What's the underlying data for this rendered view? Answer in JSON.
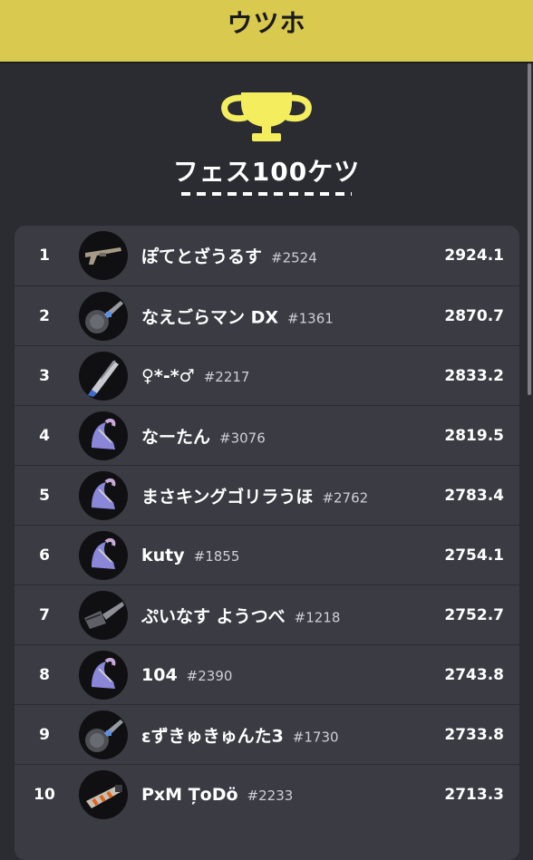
{
  "header": {
    "title": "ウツホ"
  },
  "section": {
    "title": "フェス100ケツ"
  },
  "colors": {
    "header_bg": "#d9c94f",
    "trophy": "#f4ee5e",
    "page_bg": "#2b2c32",
    "row_bg": "#3a3b43"
  },
  "rows": [
    {
      "rank": "1",
      "name": "ぽてとざうるす",
      "tag": "#2524",
      "score": "2924.1",
      "icon": "rifle-weapon-icon"
    },
    {
      "rank": "2",
      "name": "なえごらマン DX",
      "tag": "#1361",
      "score": "2870.7",
      "icon": "roller-weapon-icon"
    },
    {
      "rank": "3",
      "name": "♀*-*♂",
      "tag": "#2217",
      "score": "2833.2",
      "icon": "splatana-weapon-icon"
    },
    {
      "rank": "4",
      "name": "なーたん",
      "tag": "#3076",
      "score": "2819.5",
      "icon": "stringer-weapon-icon"
    },
    {
      "rank": "5",
      "name": "まさキングゴリラうほ",
      "tag": "#2762",
      "score": "2783.4",
      "icon": "stringer-weapon-icon"
    },
    {
      "rank": "6",
      "name": "kuty",
      "tag": "#1855",
      "score": "2754.1",
      "icon": "stringer-weapon-icon"
    },
    {
      "rank": "7",
      "name": "ぷいなす ようつべ",
      "tag": "#1218",
      "score": "2752.7",
      "icon": "brush-weapon-icon"
    },
    {
      "rank": "8",
      "name": "104",
      "tag": "#2390",
      "score": "2743.8",
      "icon": "stringer-weapon-icon"
    },
    {
      "rank": "9",
      "name": "εずきゅきゅんた3",
      "tag": "#1730",
      "score": "2733.8",
      "icon": "roller-weapon-icon"
    },
    {
      "rank": "10",
      "name": "PxM ȚoDö",
      "tag": "#2233",
      "score": "2713.3",
      "icon": "blaster-weapon-icon"
    }
  ]
}
